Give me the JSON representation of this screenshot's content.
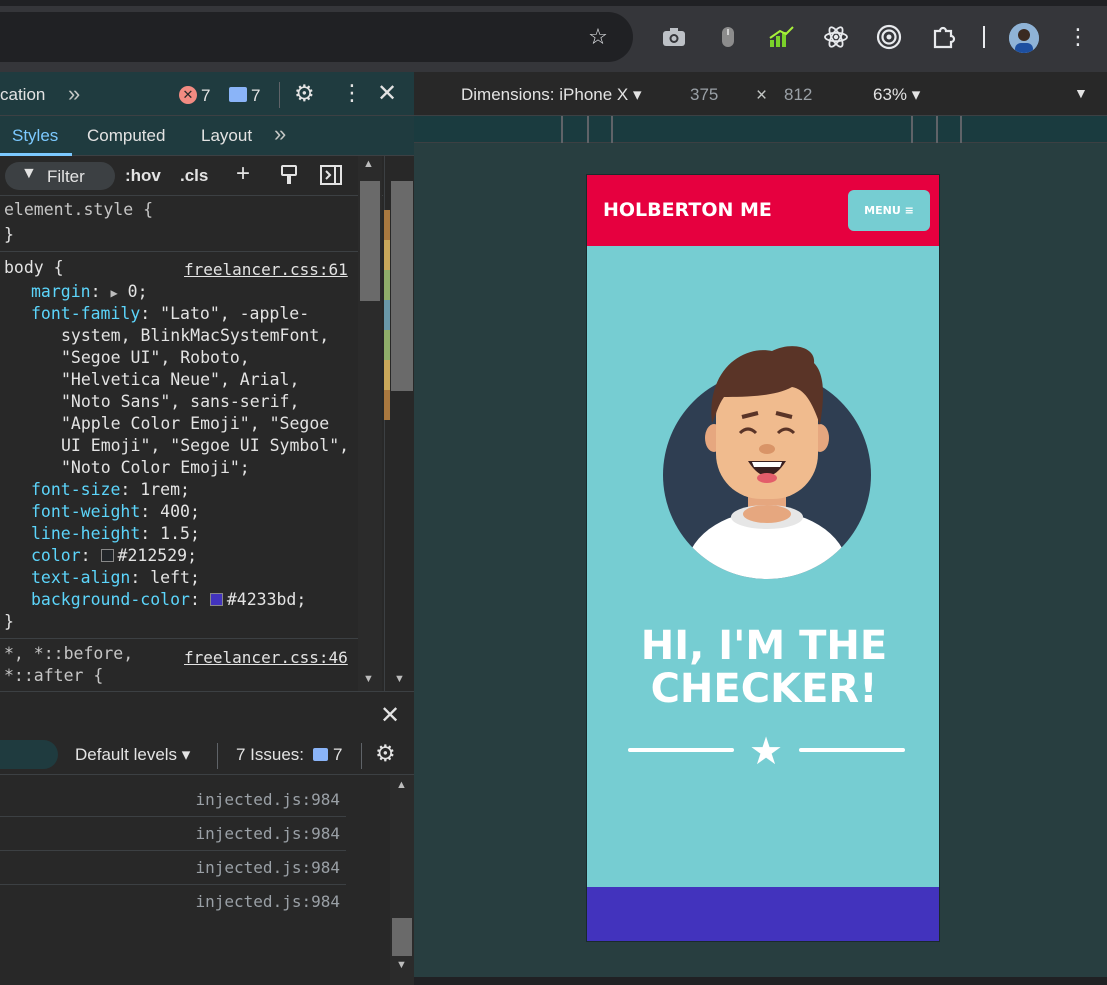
{
  "browser": {
    "toolbar_icons": [
      "star-icon",
      "camera-extension-icon",
      "mouse-extension-icon",
      "chart-extension-icon",
      "react-devtools-icon",
      "target-extension-icon",
      "puzzle-extensions-icon",
      "profile-avatar",
      "more-vert-icon"
    ]
  },
  "devtools": {
    "panel_tab_partial": "cation",
    "more_tabs": "»",
    "errors_count": "7",
    "messages_count": "7",
    "subtabs": {
      "styles": "Styles",
      "computed": "Computed",
      "layout": "Layout",
      "more": "»"
    },
    "filter": {
      "label": "Filter",
      "hov": ":hov",
      "cls": ".cls"
    },
    "rules": {
      "element_style_open": "element.style {",
      "close_brace": "}",
      "body_selector": "body {",
      "body_source": "freelancer.css:61",
      "margin_prop": "margin",
      "margin_val": "0;",
      "font_family_prop": "font-family",
      "font_family_val_1": "\"Lato\", -apple-",
      "font_family_val_2": "system, BlinkMacSystemFont,",
      "font_family_val_3": "\"Segoe UI\", Roboto,",
      "font_family_val_4": "\"Helvetica Neue\", Arial,",
      "font_family_val_5": "\"Noto Sans\", sans-serif,",
      "font_family_val_6": "\"Apple Color Emoji\", \"Segoe",
      "font_family_val_7": "UI Emoji\", \"Segoe UI Symbol\",",
      "font_family_val_8": "\"Noto Color Emoji\";",
      "font_size_prop": "font-size",
      "font_size_val": "1rem;",
      "font_weight_prop": "font-weight",
      "font_weight_val": "400;",
      "line_height_prop": "line-height",
      "line_height_val": "1.5;",
      "color_prop": "color",
      "color_val": "#212529;",
      "color_swatch": "#212529",
      "text_align_prop": "text-align",
      "text_align_val": "left;",
      "bg_color_prop": "background-color",
      "bg_color_val": "#4233bd;",
      "bg_swatch": "#4233bd",
      "universal_selector_1": "*, *::before,",
      "universal_selector_2": "*::after {",
      "universal_source": "freelancer.css:46"
    },
    "console": {
      "default_levels": "Default levels",
      "issues_label": "7 Issues:",
      "issues_count": "7",
      "rows": [
        "injected.js:984",
        "injected.js:984",
        "injected.js:984",
        "injected.js:984"
      ]
    }
  },
  "device_toolbar": {
    "dimensions_label": "Dimensions: iPhone X",
    "width": "375",
    "times": "×",
    "height": "812",
    "zoom": "63%"
  },
  "phone_page": {
    "brand": "HOLBERTON ME",
    "menu_label": "MENU ≡",
    "heading_line1": "HI, I'M THE",
    "heading_line2": "CHECKER!",
    "nav_color": "#e6003f",
    "page_color": "#76cdd2",
    "footer_color": "#4233bd"
  }
}
